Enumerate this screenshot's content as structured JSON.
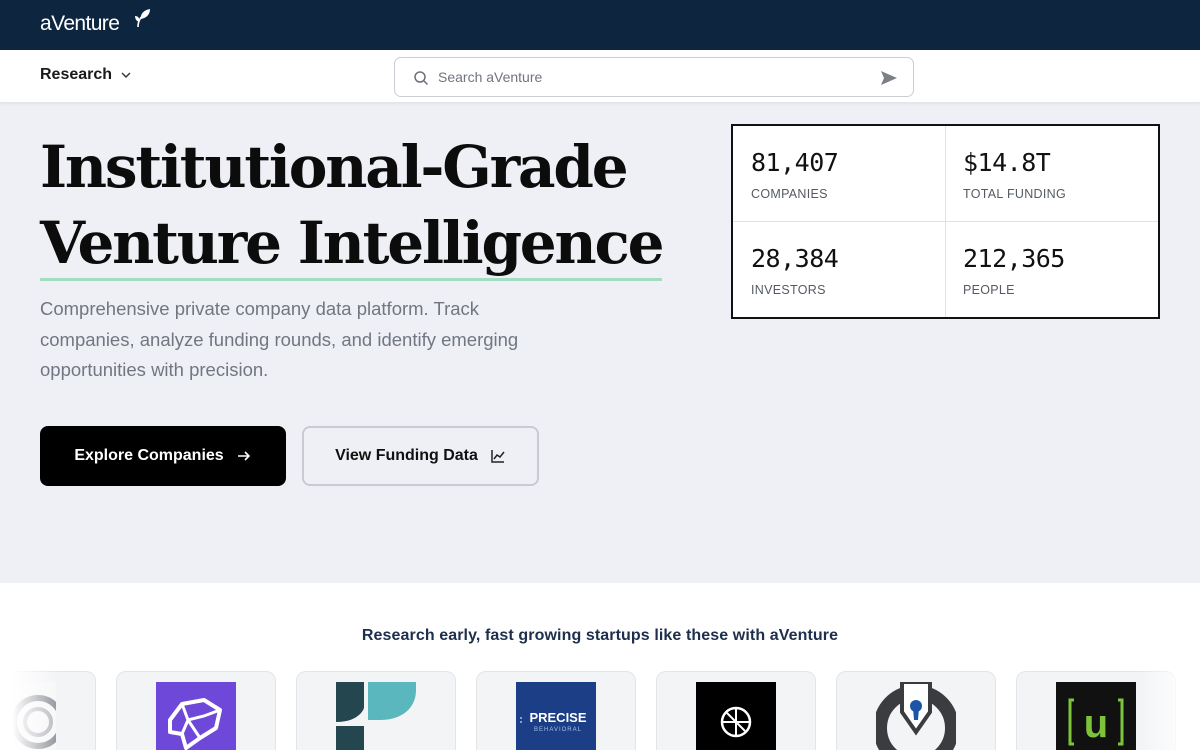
{
  "brand": {
    "name": "aVenture"
  },
  "nav": {
    "research_label": "Research"
  },
  "search": {
    "placeholder": "Search aVenture"
  },
  "hero": {
    "headline_line1": "Institutional-Grade",
    "headline_line2": "Venture Intelligence",
    "description": "Comprehensive private company data platform. Track companies, analyze funding rounds, and identify emerging opportunities with precision.",
    "primary_button": "Explore Companies",
    "secondary_button": "View Funding Data"
  },
  "stats": [
    {
      "value": "81,407",
      "label": "COMPANIES"
    },
    {
      "value": "$14.8T",
      "label": "TOTAL FUNDING"
    },
    {
      "value": "28,384",
      "label": "INVESTORS"
    },
    {
      "value": "212,365",
      "label": "PEOPLE"
    }
  ],
  "showcase": {
    "tagline": "Research early, fast growing startups like these with aVenture",
    "logos": [
      {
        "icon": "partial-circle-logo"
      },
      {
        "icon": "purple-brain-logo"
      },
      {
        "icon": "teal-f-logo"
      },
      {
        "icon": "precise-behavioral-logo",
        "text_line1": "PRECISE",
        "text_line2": "BEHAVIORAL"
      },
      {
        "icon": "black-circle-symbol-logo"
      },
      {
        "icon": "keyhole-shield-logo"
      },
      {
        "icon": "green-u-logo",
        "text": "u"
      }
    ]
  },
  "colors": {
    "topbar": "#0e2540",
    "hero_bg": "#eef0f6",
    "headline_underline": "#a3dcc0",
    "primary_button": "#000000",
    "tagline": "#1d2f4d"
  }
}
